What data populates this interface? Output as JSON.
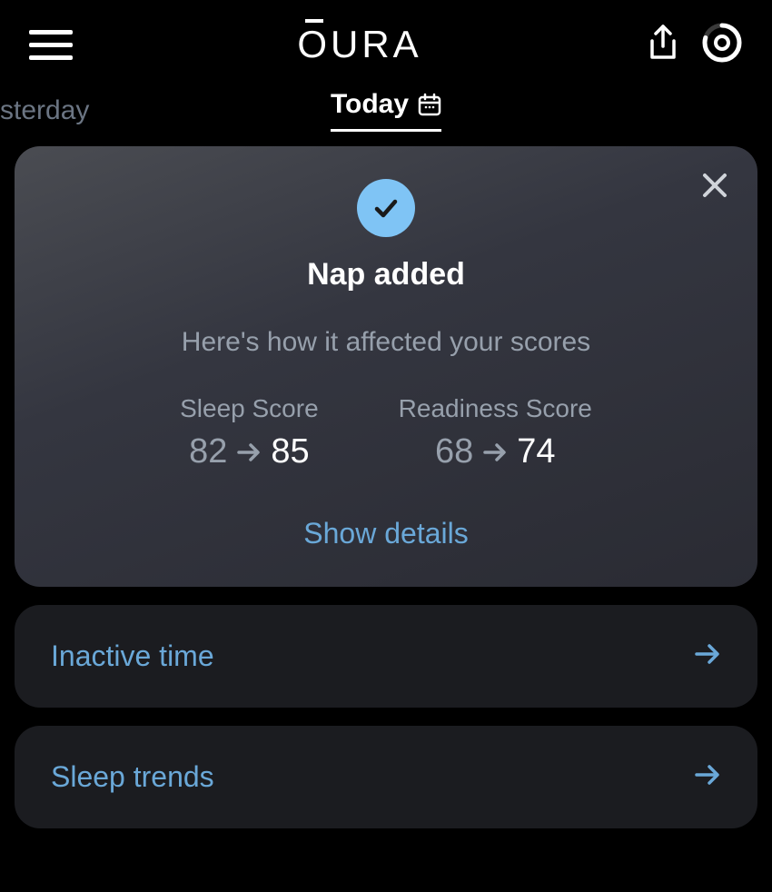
{
  "header": {
    "logo": "OURA"
  },
  "tabs": {
    "previous": "sterday",
    "current": "Today"
  },
  "napCard": {
    "title": "Nap added",
    "subtitle": "Here's how it affected your scores",
    "sleepScore": {
      "label": "Sleep Score",
      "before": "82",
      "after": "85"
    },
    "readinessScore": {
      "label": "Readiness Score",
      "before": "68",
      "after": "74"
    },
    "detailsLabel": "Show details"
  },
  "cards": {
    "inactiveTime": "Inactive time",
    "sleepTrends": "Sleep trends"
  }
}
